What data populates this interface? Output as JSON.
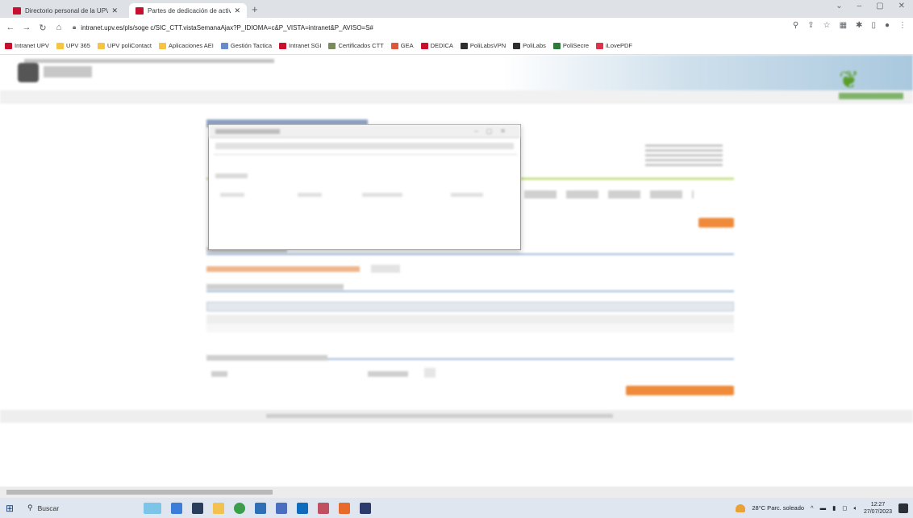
{
  "browser": {
    "tabs": [
      {
        "title": "Directorio personal de la UPV",
        "active": false
      },
      {
        "title": "Partes de dedicación de activid",
        "active": true
      }
    ],
    "new_tab_icon": "plus-icon",
    "window_controls": [
      "chevron-down-icon",
      "minimize-icon",
      "restore-icon",
      "close-icon"
    ],
    "url": "intranet.upv.es/pls/soge c/SIC_CTT.vistaSemanaAjax?P_IDIOMA=c&P_VISTA=intranet&P_AVISO=S#"
  },
  "bookmarks": [
    {
      "label": "Intranet UPV",
      "color": "#c8102e"
    },
    {
      "label": "UPV 365",
      "color": "#f5c542"
    },
    {
      "label": "UPV poliContact",
      "color": "#f5c542"
    },
    {
      "label": "Aplicaciones AEI",
      "color": "#f5c542"
    },
    {
      "label": "Gestión Tactica",
      "color": "#6a8bc9"
    },
    {
      "label": "Intranet SGI",
      "color": "#c8102e"
    },
    {
      "label": "Certificados CTT",
      "color": "#7a8a5a"
    },
    {
      "label": "GEA",
      "color": "#e0563a"
    },
    {
      "label": "DEDICA",
      "color": "#c8102e"
    },
    {
      "label": "PoliLabsVPN",
      "color": "#2f2f2f"
    },
    {
      "label": "PoliLabs",
      "color": "#2f2f2f"
    },
    {
      "label": "PoliSecre",
      "color": "#2d7a3a"
    },
    {
      "label": "iLovePDF",
      "color": "#e0304a"
    }
  ],
  "taskbar": {
    "search_placeholder": "Buscar",
    "weather": "28°C  Parc. soleado",
    "time": "12:27",
    "date": "27/07/2023"
  },
  "colors": {
    "accent_orange": "#ee8a3a",
    "header_blue": "#a9c8de",
    "upv_red": "#c8102e"
  }
}
